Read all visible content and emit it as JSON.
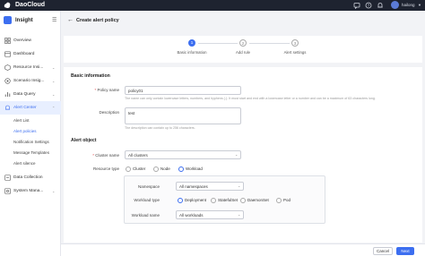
{
  "topbar": {
    "brand": "DaoCloud",
    "user_name": "hailong"
  },
  "sidebar": {
    "app_title": "Insight",
    "items": [
      {
        "label": "Overview",
        "icon": "grid-icon"
      },
      {
        "label": "Dashboard",
        "icon": "dashboard-icon"
      },
      {
        "label": "Resource Insi...",
        "icon": "cube-icon"
      },
      {
        "label": "Scenario Insig...",
        "icon": "scenario-icon"
      },
      {
        "label": "Data Query",
        "icon": "chart-icon"
      },
      {
        "label": "Alert Center",
        "icon": "bell-icon"
      }
    ],
    "alert_sub_items": [
      {
        "label": "Alert List"
      },
      {
        "label": "Alert policies"
      },
      {
        "label": "Notification Settings"
      },
      {
        "label": "Message Templates"
      },
      {
        "label": "Alert silence"
      }
    ],
    "bottom_items": [
      {
        "label": "Data Collection",
        "icon": "collection-icon"
      },
      {
        "label": "System Mana...",
        "icon": "settings-icon"
      }
    ]
  },
  "page": {
    "title": "Create alert policy"
  },
  "steps": [
    {
      "num": "1",
      "label": "Basic information"
    },
    {
      "num": "2",
      "label": "Add rule"
    },
    {
      "num": "3",
      "label": "Alert settings"
    }
  ],
  "basic": {
    "section_title": "Basic information",
    "policy_name_label": "Policy name",
    "policy_name_value": "policy01",
    "policy_name_help": "The name can only contain lowercase letters, numbers, and hyphens (-). It must start and end with a lowercase letter or a number and can be a maximum of 63 characters long.",
    "description_label": "Description",
    "description_value": "test",
    "description_help": "The description can contain up to 256 characters."
  },
  "alert_object": {
    "section_title": "Alert object",
    "cluster_label": "Cluster name",
    "cluster_value": "All clusters",
    "resource_type_label": "Resource type",
    "resource_types": [
      "Cluster",
      "Node",
      "Workload"
    ],
    "namespace_label": "Namespace",
    "namespace_value": "All namespaces",
    "workload_type_label": "Workload type",
    "workload_types": [
      "Deployment",
      "StatefulSet",
      "DaemonSet",
      "Pod"
    ],
    "workload_name_label": "Workload name",
    "workload_name_value": "All workloads"
  },
  "footer": {
    "cancel_label": "Cancel",
    "next_label": "Next"
  },
  "colors": {
    "accent": "#3c6ef0",
    "topbar": "#1e2330",
    "required": "#e24b4b"
  }
}
